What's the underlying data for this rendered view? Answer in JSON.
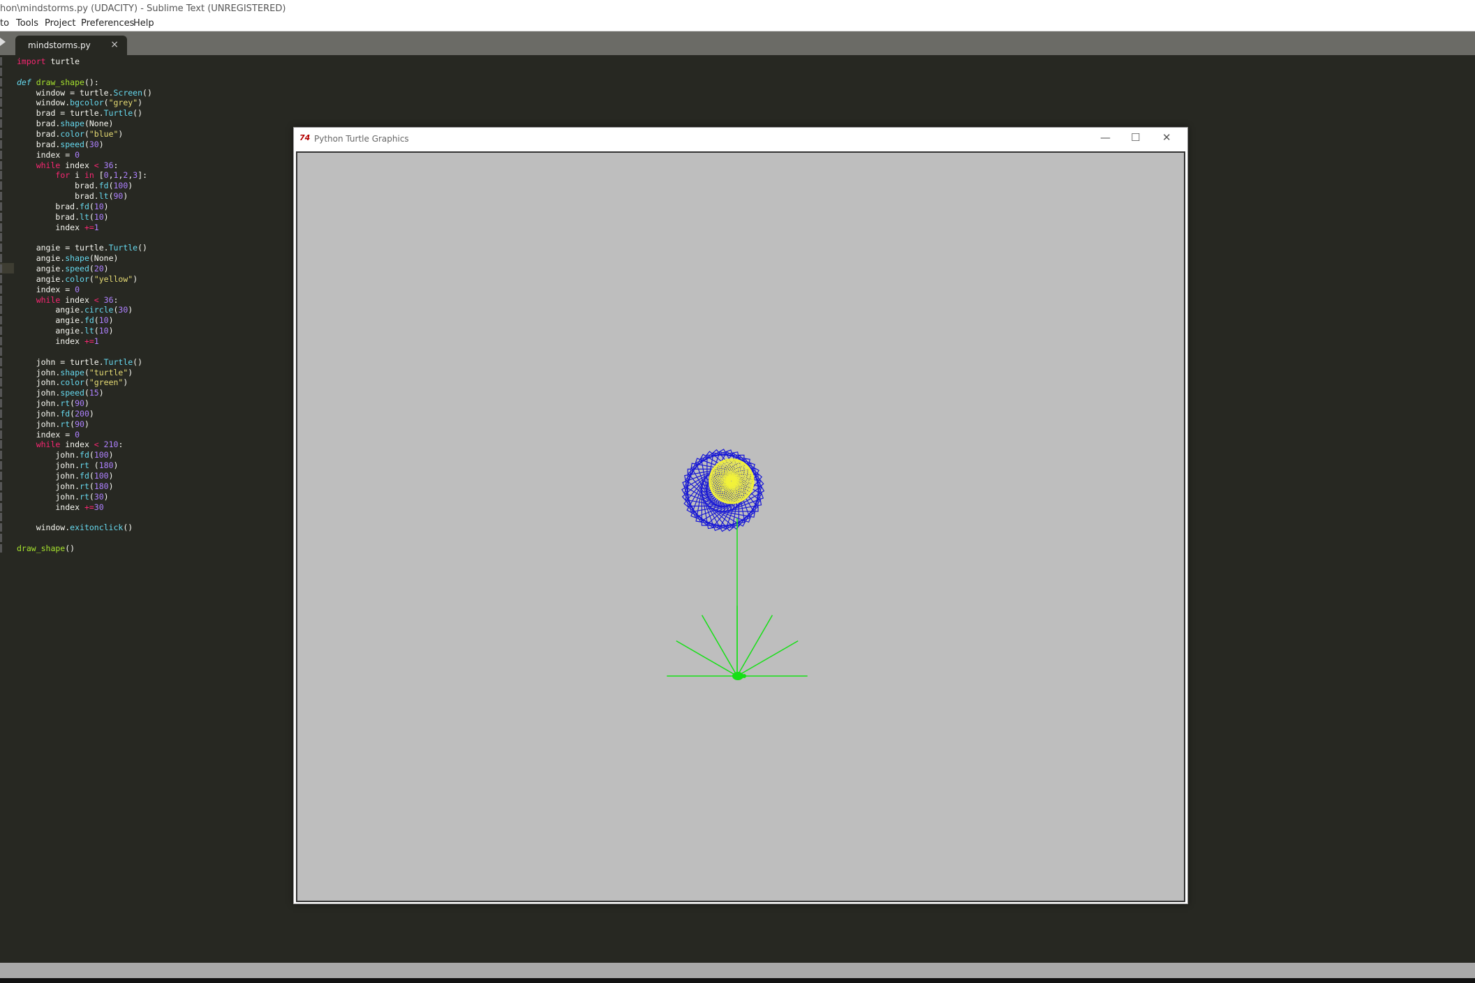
{
  "editor_window": {
    "title": "hon\\mindstorms.py (UDACITY) - Sublime Text (UNREGISTERED)"
  },
  "menu": {
    "items": [
      "to",
      "Tools",
      "Project",
      "Preferences",
      "Help"
    ]
  },
  "tab": {
    "filename": "mindstorms.py",
    "close_glyph": "×"
  },
  "code_lines": [
    "import turtle",
    "",
    "def draw_shape():",
    "    window = turtle.Screen()",
    "    window.bgcolor(\"grey\")",
    "    brad = turtle.Turtle()",
    "    brad.shape(None)",
    "    brad.color(\"blue\")",
    "    brad.speed(30)",
    "    index = 0",
    "    while index < 36:",
    "        for i in [0,1,2,3]:",
    "            brad.fd(100)",
    "            brad.lt(90)",
    "        brad.fd(10)",
    "        brad.lt(10)",
    "        index +=1",
    "",
    "    angie = turtle.Turtle()",
    "    angie.shape(None)",
    "    angie.speed(20)",
    "    angie.color(\"yellow\")",
    "    index = 0",
    "    while index < 36:",
    "        angie.circle(30)",
    "        angie.fd(10)",
    "        angie.lt(10)",
    "        index +=1",
    "",
    "    john = turtle.Turtle()",
    "    john.shape(\"turtle\")",
    "    john.color(\"green\")",
    "    john.speed(15)",
    "    john.rt(90)",
    "    john.fd(200)",
    "    john.rt(90)",
    "    index = 0",
    "    while index < 210:",
    "        john.fd(100)",
    "        john.rt (180)",
    "        john.fd(100)",
    "        john.rt(180)",
    "        john.rt(30)",
    "        index +=30",
    "",
    "    window.exitonclick()",
    "",
    "draw_shape()"
  ],
  "turtle_window": {
    "title": "Python Turtle Graphics",
    "minimize_glyph": "—",
    "maximize_glyph": "☐",
    "close_glyph": "✕",
    "icon_text": "74",
    "canvas_bg": "#bebebe",
    "colors": {
      "squares": "#1a1ad4",
      "circles": "#f2f23a",
      "stem": "#16e016"
    }
  },
  "colors": {
    "editor_bg": "#272822",
    "keyword": "#f92672",
    "function": "#a6e22e",
    "builtin": "#66d9ef",
    "number": "#ae81ff",
    "string": "#e6db74"
  }
}
